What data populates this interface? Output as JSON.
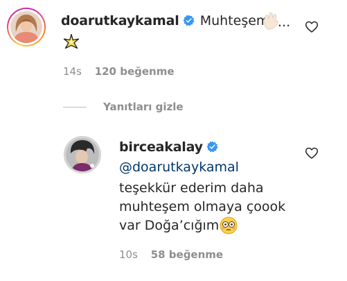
{
  "comment1": {
    "username": "doarutkaykamal",
    "verified": true,
    "text": "Muhteşem!",
    "ellipsis": "...",
    "emoji_line": "sparkle-star",
    "time": "14s",
    "likes": "120 beğenme"
  },
  "replies_toggle": "Yanıtları gizle",
  "reply": {
    "username": "birceakalay",
    "verified": true,
    "mention": "@doarutkaykamal",
    "lines": [
      "teşekkür ederim daha",
      "muhteşem olmaya çoook",
      "var Doğa’cığım"
    ],
    "time": "10s",
    "likes": "58 beğenme"
  },
  "colors": {
    "verified_blue": "#3897f0",
    "mention_blue": "#00376b",
    "meta_gray": "#8e8e8e",
    "text": "#262626"
  }
}
